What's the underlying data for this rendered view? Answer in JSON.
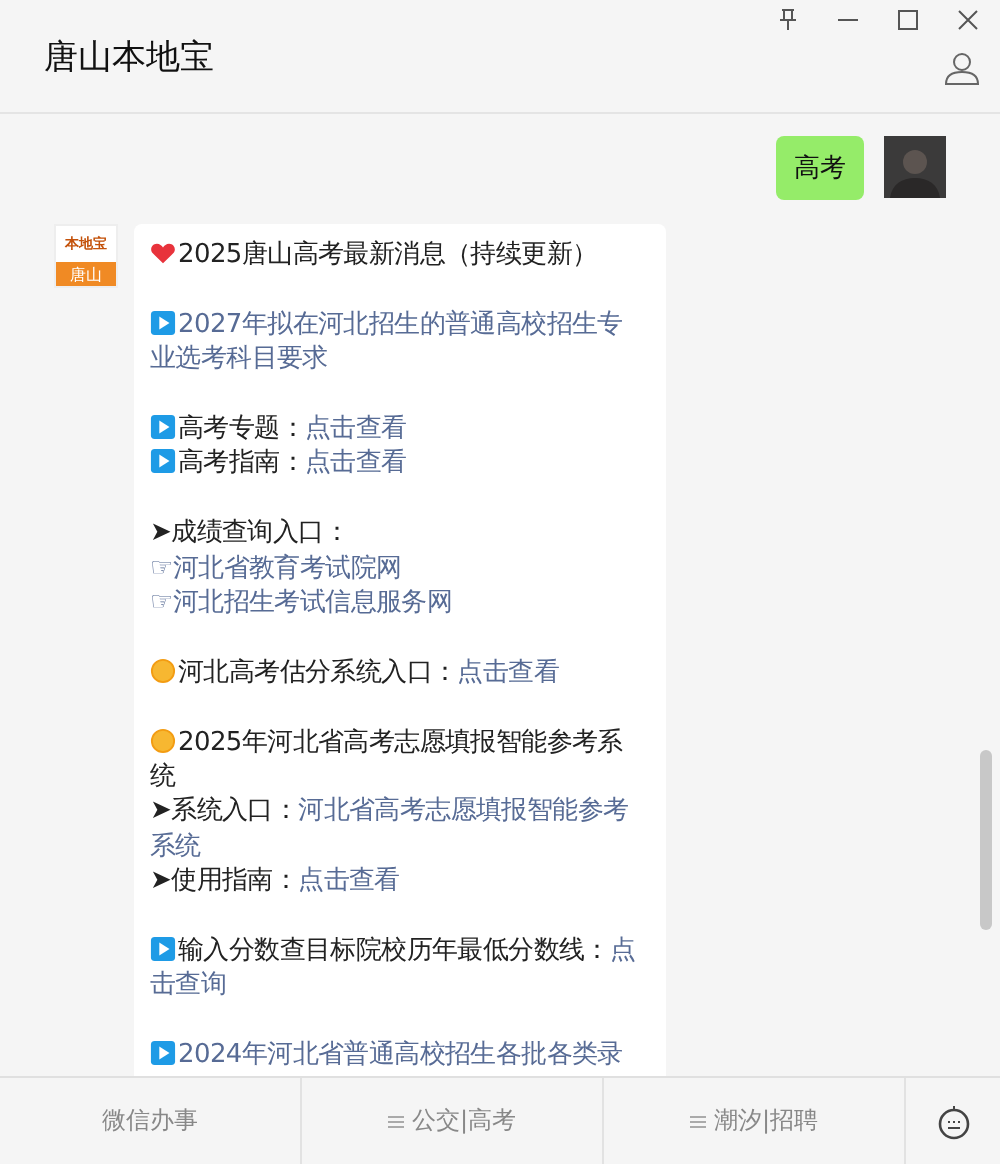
{
  "window": {
    "title": "唐山本地宝"
  },
  "user_message": {
    "text": "高考"
  },
  "bot": {
    "avatar_top": "本地宝",
    "avatar_bottom": "唐山"
  },
  "blocks": [
    {
      "lines": [
        {
          "kind": "heart",
          "parts": [
            {
              "kind": "text",
              "text": "2025唐山高考最新消息（持续更新）"
            }
          ]
        }
      ]
    },
    {
      "lines": [
        {
          "kind": "play",
          "parts": [
            {
              "kind": "link",
              "text": "2027年拟在河北招生的普通高校招生专"
            }
          ]
        },
        {
          "kind": "plain",
          "parts": [
            {
              "kind": "link",
              "text": "业选考科目要求"
            }
          ]
        }
      ]
    },
    {
      "lines": [
        {
          "kind": "play",
          "parts": [
            {
              "kind": "text",
              "text": "高考专题："
            },
            {
              "kind": "link",
              "text": "点击查看"
            }
          ]
        },
        {
          "kind": "play",
          "parts": [
            {
              "kind": "text",
              "text": "高考指南："
            },
            {
              "kind": "link",
              "text": "点击查看"
            }
          ]
        }
      ]
    },
    {
      "lines": [
        {
          "kind": "plain",
          "parts": [
            {
              "kind": "text",
              "text": "➤成绩查询入口："
            }
          ]
        },
        {
          "kind": "plain",
          "parts": [
            {
              "kind": "link",
              "text": "☞河北省教育考试院网"
            }
          ]
        },
        {
          "kind": "plain",
          "parts": [
            {
              "kind": "link",
              "text": "☞河北招生考试信息服务网"
            }
          ]
        }
      ]
    },
    {
      "lines": [
        {
          "kind": "sun",
          "parts": [
            {
              "kind": "text",
              "text": "河北高考估分系统入口："
            },
            {
              "kind": "link",
              "text": "点击查看"
            }
          ]
        }
      ]
    },
    {
      "lines": [
        {
          "kind": "sun",
          "parts": [
            {
              "kind": "text",
              "text": "2025年河北省高考志愿填报智能参考系"
            }
          ]
        },
        {
          "kind": "plain",
          "parts": [
            {
              "kind": "text",
              "text": "统"
            }
          ]
        },
        {
          "kind": "plain",
          "parts": [
            {
              "kind": "text",
              "text": "➤系统入口："
            },
            {
              "kind": "link",
              "text": "河北省高考志愿填报智能参考"
            }
          ]
        },
        {
          "kind": "plain",
          "parts": [
            {
              "kind": "link",
              "text": "系统"
            }
          ]
        },
        {
          "kind": "plain",
          "parts": [
            {
              "kind": "text",
              "text": "➤使用指南："
            },
            {
              "kind": "link",
              "text": "点击查看"
            }
          ]
        }
      ]
    },
    {
      "lines": [
        {
          "kind": "play",
          "parts": [
            {
              "kind": "text",
              "text": "输入分数查目标院校历年最低分数线："
            },
            {
              "kind": "link",
              "text": "点"
            }
          ]
        },
        {
          "kind": "plain",
          "parts": [
            {
              "kind": "link",
              "text": "击查询"
            }
          ]
        }
      ]
    },
    {
      "lines": [
        {
          "kind": "play",
          "parts": [
            {
              "kind": "link",
              "text": "2024年河北省普通高校招生各批各类录"
            }
          ]
        }
      ]
    }
  ],
  "menu": [
    {
      "label": "微信办事",
      "has_menu": false
    },
    {
      "label": "公交|高考",
      "has_menu": true
    },
    {
      "label": "潮汐|招聘",
      "has_menu": true
    }
  ]
}
